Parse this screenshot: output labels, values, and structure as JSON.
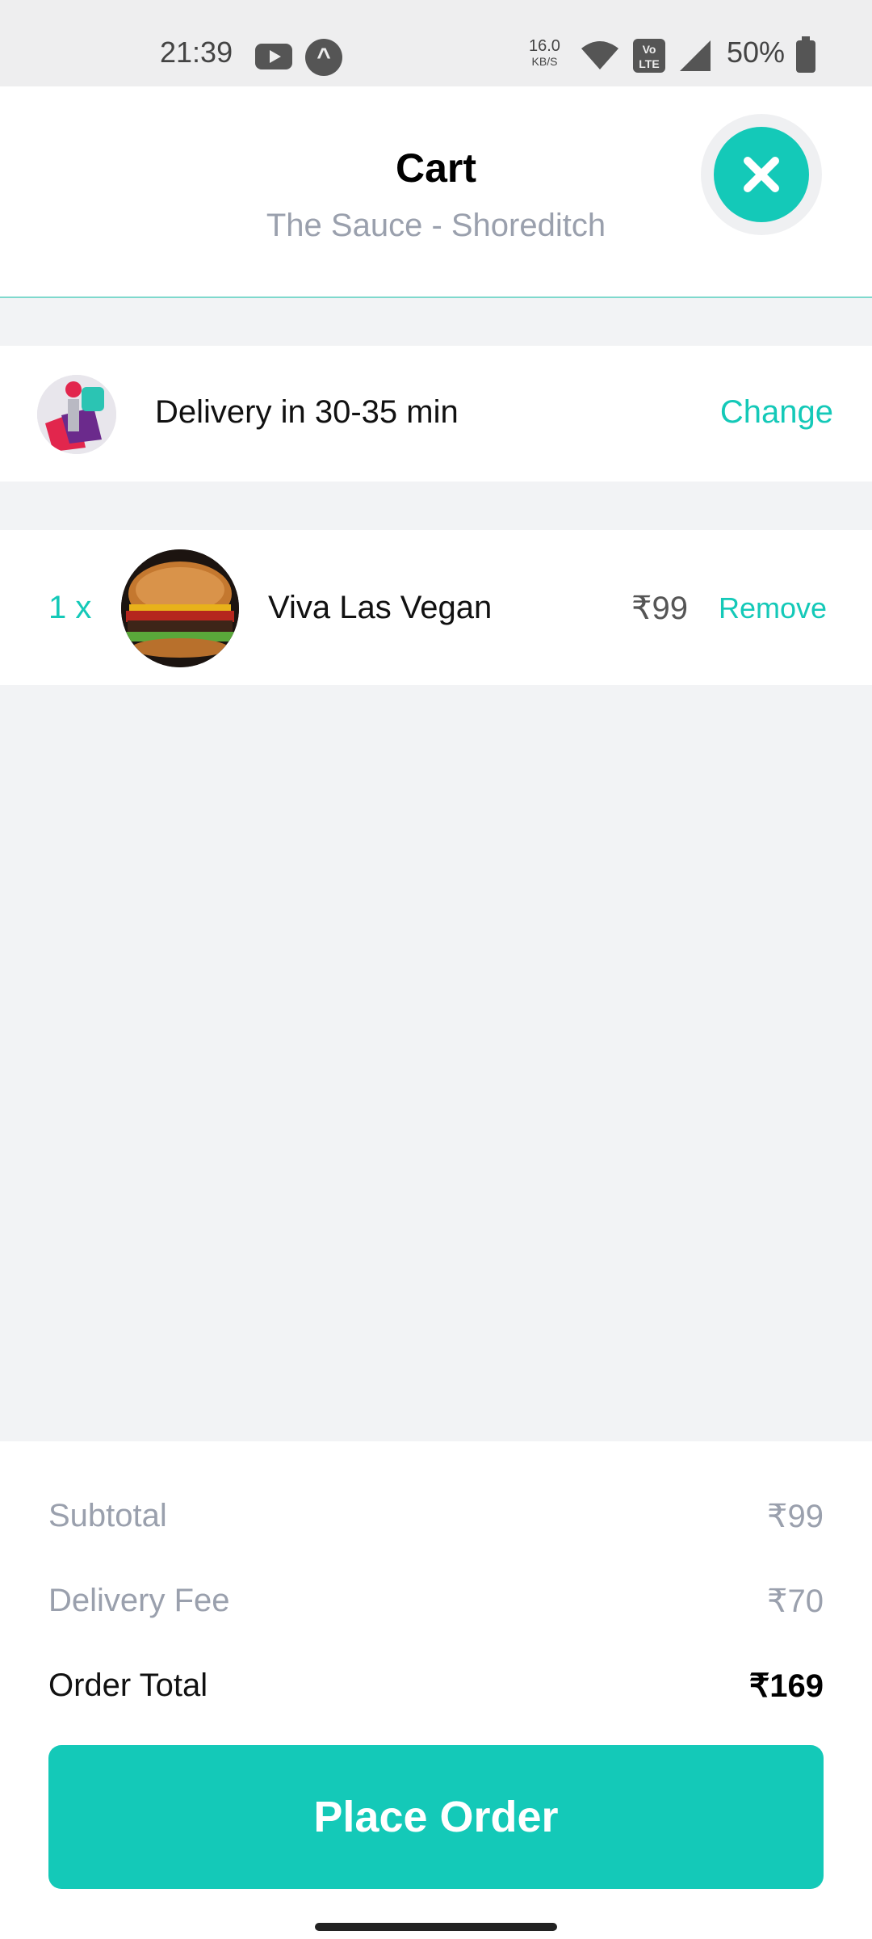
{
  "status_bar": {
    "time": "21:39",
    "speed_value": "16.0",
    "speed_unit": "KB/S",
    "volte": "Vo LTE",
    "battery": "50%"
  },
  "header": {
    "title": "Cart",
    "subtitle": "The Sauce - Shoreditch"
  },
  "delivery": {
    "text": "Delivery in 30-35 min",
    "change_label": "Change"
  },
  "items": [
    {
      "qty": "1 x",
      "name": "Viva Las Vegan",
      "price": "₹99",
      "remove_label": "Remove"
    }
  ],
  "summary": {
    "subtotal_label": "Subtotal",
    "subtotal_value": "₹99",
    "delivery_fee_label": "Delivery Fee",
    "delivery_fee_value": "₹70",
    "total_label": "Order Total",
    "total_value": "₹169"
  },
  "place_order_label": "Place Order",
  "colors": {
    "accent": "#14c9b8",
    "muted": "#9aa0ad",
    "background": "#f2f3f5"
  }
}
